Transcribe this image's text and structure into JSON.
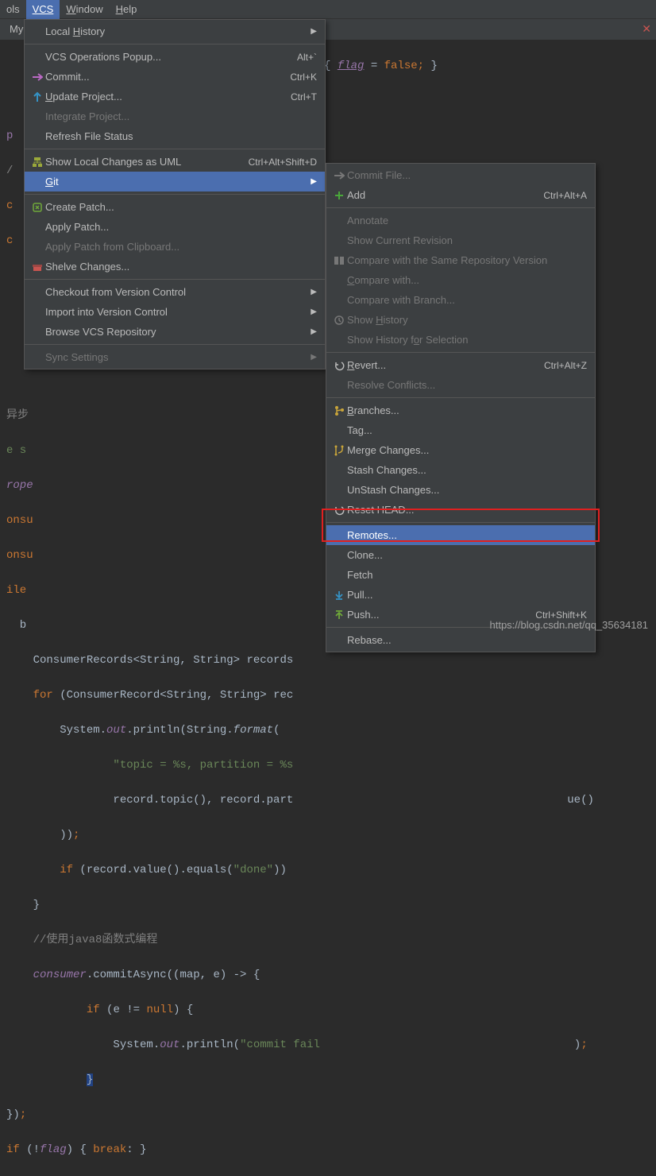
{
  "menubar": {
    "ols": "ols",
    "vcs": "VCS",
    "window": "Window",
    "help": "Help"
  },
  "tab": {
    "label": "MyC"
  },
  "code": {
    "l0": "{ flag = false; }",
    "l8": "异步",
    "l9": "e s",
    "l10": "rope",
    "l11": "onsu",
    "l12": "onsu",
    "l13": "ile",
    "l14": "  b",
    "l_cr": "    ConsumerRecords<String, String> records",
    "l_for": "    for (ConsumerRecord<String, String> rec",
    "l_sout": "        System.out.println(String.format(",
    "l_topic": "                \"topic = %s, partition = %s",
    "l_rec": "                record.topic(), record.part",
    "l_ue": "ue()",
    "l_pp": "        ));",
    "l_if": "        if (record.value().equals(\"done\"))",
    "l_rb": "    }",
    "l_cmt": "    //使用java8函数式编程",
    "l_ca": "    consumer.commitAsync((map, e) -> {",
    "l_en": "            if (e != null) {",
    "l_pf": "                System.out.println(\"commit fail",
    "l_end": ");",
    "l_cur": "            }",
    "l_rb2": "});",
    "l_last": "if (!flag) { break: }"
  },
  "vcs_menu": {
    "local_history": "Local History",
    "vcs_ops": "VCS Operations Popup...",
    "vcs_ops_sc": "Alt+`",
    "commit": "Commit...",
    "commit_sc": "Ctrl+K",
    "update": "Update Project...",
    "update_sc": "Ctrl+T",
    "integrate": "Integrate Project...",
    "refresh": "Refresh File Status",
    "uml": "Show Local Changes as UML",
    "uml_sc": "Ctrl+Alt+Shift+D",
    "git": "Git",
    "create_patch": "Create Patch...",
    "apply_patch": "Apply Patch...",
    "apply_clip": "Apply Patch from Clipboard...",
    "shelve": "Shelve Changes...",
    "checkout_vc": "Checkout from Version Control",
    "import_vc": "Import into Version Control",
    "browse_repo": "Browse VCS Repository",
    "sync": "Sync Settings"
  },
  "git_menu": {
    "commit_file": "Commit File...",
    "add": "Add",
    "add_sc": "Ctrl+Alt+A",
    "annotate": "Annotate",
    "show_rev": "Show Current Revision",
    "compare_same": "Compare with the Same Repository Version",
    "compare_with": "Compare with...",
    "compare_branch": "Compare with Branch...",
    "show_hist": "Show History",
    "show_hist_sel": "Show History for Selection",
    "revert": "Revert...",
    "revert_sc": "Ctrl+Alt+Z",
    "resolve": "Resolve Conflicts...",
    "branches": "Branches...",
    "tag": "Tag...",
    "merge": "Merge Changes...",
    "stash": "Stash Changes...",
    "unstash": "UnStash Changes...",
    "reset": "Reset HEAD...",
    "remotes": "Remotes...",
    "clone": "Clone...",
    "fetch": "Fetch",
    "pull": "Pull...",
    "push": "Push...",
    "push_sc": "Ctrl+Shift+K",
    "rebase": "Rebase..."
  },
  "watermark": "https://blog.csdn.net/qq_35634181"
}
